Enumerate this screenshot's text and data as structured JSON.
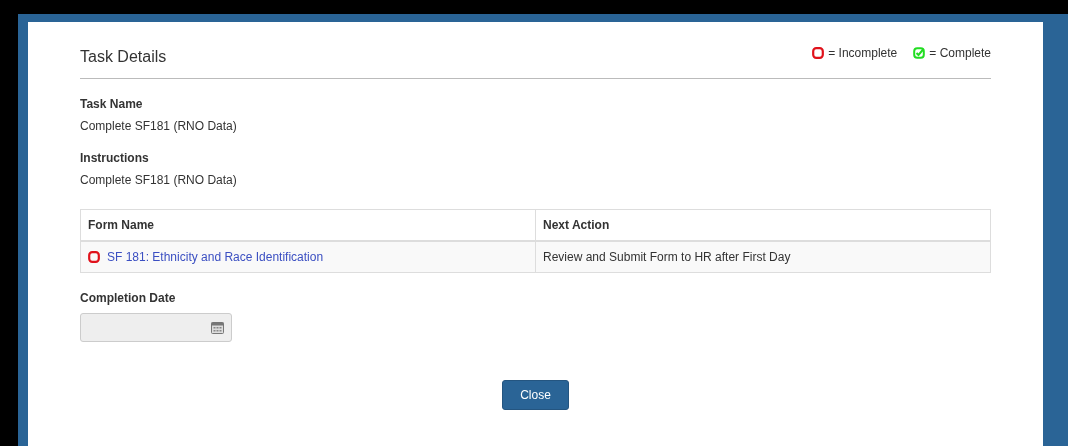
{
  "modal": {
    "title": "Task Details",
    "legend": [
      {
        "kind": "incomplete",
        "label": "= Incomplete"
      },
      {
        "kind": "complete",
        "label": "= Complete"
      }
    ],
    "fields": [
      {
        "label": "Task Name",
        "value": "Complete SF181 (RNO Data)"
      },
      {
        "label": "Instructions",
        "value": "Complete SF181 (RNO Data)"
      }
    ],
    "table": {
      "columns": [
        "Form Name",
        "Next Action"
      ],
      "rows": [
        {
          "kind": "incomplete",
          "form_name": "SF 181: Ethnicity and Race Identification",
          "next_action": "Review and Submit Form to HR after First Day"
        }
      ]
    },
    "completion_date": {
      "label": "Completion Date",
      "disabled": true
    },
    "buttons": [
      "Close"
    ]
  }
}
